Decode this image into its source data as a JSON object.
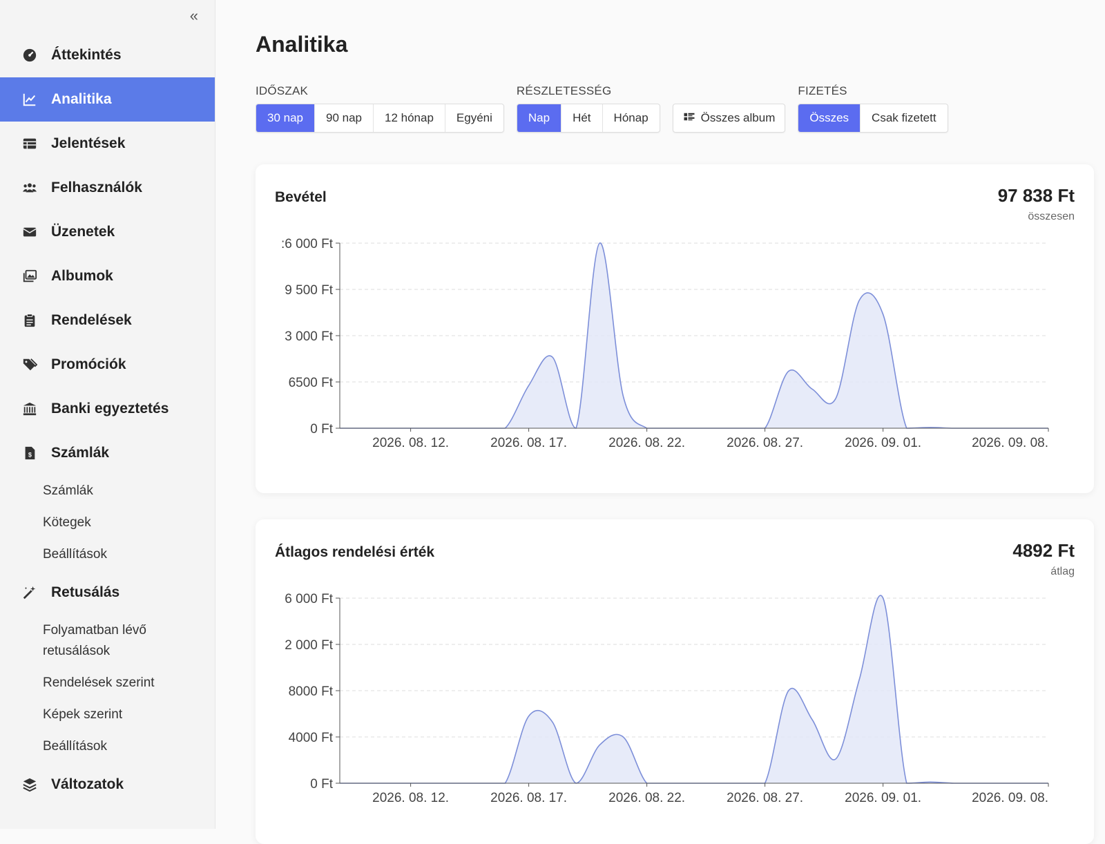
{
  "sidebar": {
    "collapse_label": "«",
    "items": [
      {
        "label": "Áttekintés",
        "icon": "dashboard-icon"
      },
      {
        "label": "Analitika",
        "icon": "chart-line-icon",
        "active": true
      },
      {
        "label": "Jelentések",
        "icon": "table-icon"
      },
      {
        "label": "Felhasználók",
        "icon": "users-icon"
      },
      {
        "label": "Üzenetek",
        "icon": "envelope-icon"
      },
      {
        "label": "Albumok",
        "icon": "images-icon"
      },
      {
        "label": "Rendelések",
        "icon": "clipboard-icon"
      },
      {
        "label": "Promóciók",
        "icon": "tags-icon"
      },
      {
        "label": "Banki egyeztetés",
        "icon": "bank-icon"
      },
      {
        "label": "Számlák",
        "icon": "invoice-icon"
      },
      {
        "label": "Retusálás",
        "icon": "magic-wand-icon"
      },
      {
        "label": "Változatok",
        "icon": "layers-icon"
      }
    ],
    "invoices_sub": [
      "Számlák",
      "Kötegek",
      "Beállítások"
    ],
    "retouch_sub": [
      "Folyamatban lévő retusálások",
      "Rendelések szerint",
      "Képek szerint",
      "Beállítások"
    ]
  },
  "page": {
    "title": "Analitika"
  },
  "filters": {
    "period": {
      "label": "IDŐSZAK",
      "options": [
        "30 nap",
        "90 nap",
        "12 hónap",
        "Egyéni"
      ],
      "selected": "30 nap"
    },
    "granularity": {
      "label": "RÉSZLETESSÉG",
      "options": [
        "Nap",
        "Hét",
        "Hónap"
      ],
      "selected": "Nap"
    },
    "album": {
      "label": "Összes album",
      "icon": "album-icon"
    },
    "payment": {
      "label": "FIZETÉS",
      "options": [
        "Összes",
        "Csak fizetett"
      ],
      "selected": "Összes"
    }
  },
  "colors": {
    "accent": "#5b6cf0",
    "sidebar_active": "#5b7be8",
    "area_fill": "#e3e7f8",
    "area_line": "#7d8fd9"
  },
  "cards": [
    {
      "title": "Bevétel",
      "total": "97 838 Ft",
      "caption": "összesen"
    },
    {
      "title": "Átlagos rendelési érték",
      "total": "4892 Ft",
      "caption": "átlag"
    }
  ],
  "chart_data": [
    {
      "type": "area",
      "title": "Bevétel",
      "x_ticks": [
        "2026. 08. 12.",
        "2026. 08. 17.",
        "2026. 08. 22.",
        "2026. 08. 27.",
        "2026. 09. 01.",
        "2026. 09. 08."
      ],
      "y_ticks": [
        ":6 000 Ft",
        "9 500 Ft",
        "3 000 Ft",
        "6500 Ft",
        "0 Ft"
      ],
      "ylim": [
        0,
        26000
      ],
      "x": [
        "2026. 08. 09.",
        "2026. 08. 10.",
        "2026. 08. 11.",
        "2026. 08. 12.",
        "2026. 08. 13.",
        "2026. 08. 14.",
        "2026. 08. 15.",
        "2026. 08. 16.",
        "2026. 08. 17.",
        "2026. 08. 18.",
        "2026. 08. 19.",
        "2026. 08. 20.",
        "2026. 08. 21.",
        "2026. 08. 22.",
        "2026. 08. 23.",
        "2026. 08. 24.",
        "2026. 08. 25.",
        "2026. 08. 26.",
        "2026. 08. 27.",
        "2026. 08. 28.",
        "2026. 08. 29.",
        "2026. 08. 30.",
        "2026. 08. 31.",
        "2026. 09. 01.",
        "2026. 09. 02.",
        "2026. 09. 03.",
        "2026. 09. 04.",
        "2026. 09. 05.",
        "2026. 09. 06.",
        "2026. 09. 07.",
        "2026. 09. 08."
      ],
      "values": [
        0,
        0,
        0,
        0,
        0,
        0,
        0,
        0,
        6000,
        10000,
        0,
        26000,
        4500,
        0,
        0,
        0,
        0,
        0,
        0,
        8000,
        5500,
        4200,
        18000,
        16000,
        0,
        100,
        0,
        0,
        0,
        0,
        0
      ],
      "grid": true
    },
    {
      "type": "area",
      "title": "Átlagos rendelési érték",
      "x_ticks": [
        "2026. 08. 12.",
        "2026. 08. 17.",
        "2026. 08. 22.",
        "2026. 08. 27.",
        "2026. 09. 01.",
        "2026. 09. 08."
      ],
      "y_ticks": [
        "6 000 Ft",
        "2 000 Ft",
        "8000 Ft",
        "4000 Ft",
        "0 Ft"
      ],
      "ylim": [
        0,
        16000
      ],
      "x": [
        "2026. 08. 09.",
        "2026. 08. 10.",
        "2026. 08. 11.",
        "2026. 08. 12.",
        "2026. 08. 13.",
        "2026. 08. 14.",
        "2026. 08. 15.",
        "2026. 08. 16.",
        "2026. 08. 17.",
        "2026. 08. 18.",
        "2026. 08. 19.",
        "2026. 08. 20.",
        "2026. 08. 21.",
        "2026. 08. 22.",
        "2026. 08. 23.",
        "2026. 08. 24.",
        "2026. 08. 25.",
        "2026. 08. 26.",
        "2026. 08. 27.",
        "2026. 08. 28.",
        "2026. 08. 29.",
        "2026. 08. 30.",
        "2026. 08. 31.",
        "2026. 09. 01.",
        "2026. 09. 02.",
        "2026. 09. 03.",
        "2026. 09. 04.",
        "2026. 09. 05.",
        "2026. 09. 06.",
        "2026. 09. 07.",
        "2026. 09. 08."
      ],
      "values": [
        0,
        0,
        0,
        0,
        0,
        0,
        0,
        0,
        5800,
        5300,
        0,
        3300,
        4000,
        0,
        0,
        0,
        0,
        0,
        0,
        8000,
        5500,
        2100,
        9000,
        16000,
        0,
        100,
        0,
        0,
        0,
        0,
        0
      ],
      "grid": true
    }
  ]
}
